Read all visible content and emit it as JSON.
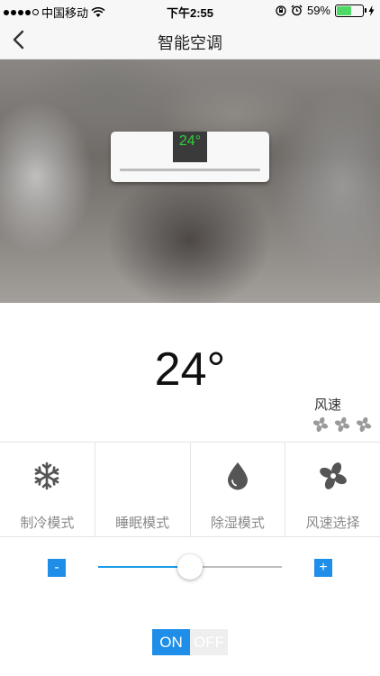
{
  "status_bar": {
    "carrier": "中国移动",
    "time": "下午2:55",
    "battery_percent": "59%",
    "battery_level": 0.59,
    "icons": [
      "signal-dots-icon",
      "wifi-icon",
      "orientation-lock-icon",
      "alarm-icon",
      "battery-icon",
      "charging-icon"
    ]
  },
  "nav": {
    "title": "智能空调",
    "back_icon": "chevron-left-icon"
  },
  "ac": {
    "display_temp": "24°"
  },
  "temperature": "24°",
  "wind": {
    "label": "风速",
    "fan_icon_count": 3
  },
  "modes": [
    {
      "label": "制冷模式",
      "icon": "snowflake-icon"
    },
    {
      "label": "睡眠模式",
      "icon": "moon-icon"
    },
    {
      "label": "除湿模式",
      "icon": "water-drop-icon"
    },
    {
      "label": "风速选择",
      "icon": "fan-icon"
    }
  ],
  "slider": {
    "minus_label": "-",
    "plus_label": "+",
    "value_fraction": 0.5
  },
  "power": {
    "on_label": "ON",
    "off_label": "OFF",
    "state": "ON"
  },
  "colors": {
    "accent": "#1f8ee8",
    "slider_fill": "#1a9be6",
    "ac_display_text": "#2fd23c",
    "battery": "#4cd964"
  }
}
